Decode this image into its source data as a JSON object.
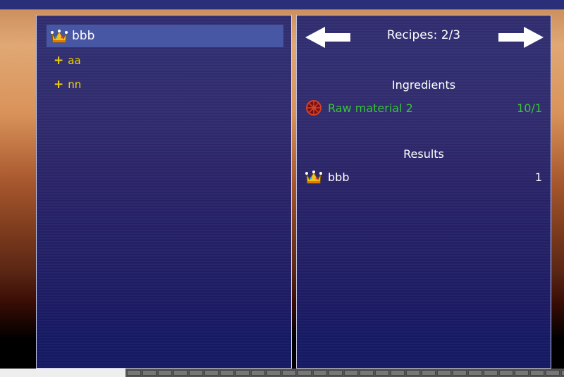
{
  "recipes": {
    "items": [
      {
        "label": "bbb",
        "icon": "crown-icon",
        "selected": true
      },
      {
        "label": "aa",
        "prefix": "+"
      },
      {
        "label": "nn",
        "prefix": "+"
      }
    ]
  },
  "detail": {
    "header": "Recipes: 2/3",
    "ingredients_title": "Ingredients",
    "ingredients": [
      {
        "name": "Raw material 2",
        "count": "10/1",
        "icon": "wheel-icon",
        "color": "#37c437"
      }
    ],
    "results_title": "Results",
    "results": [
      {
        "name": "bbb",
        "count": "1",
        "icon": "crown-icon"
      }
    ]
  }
}
